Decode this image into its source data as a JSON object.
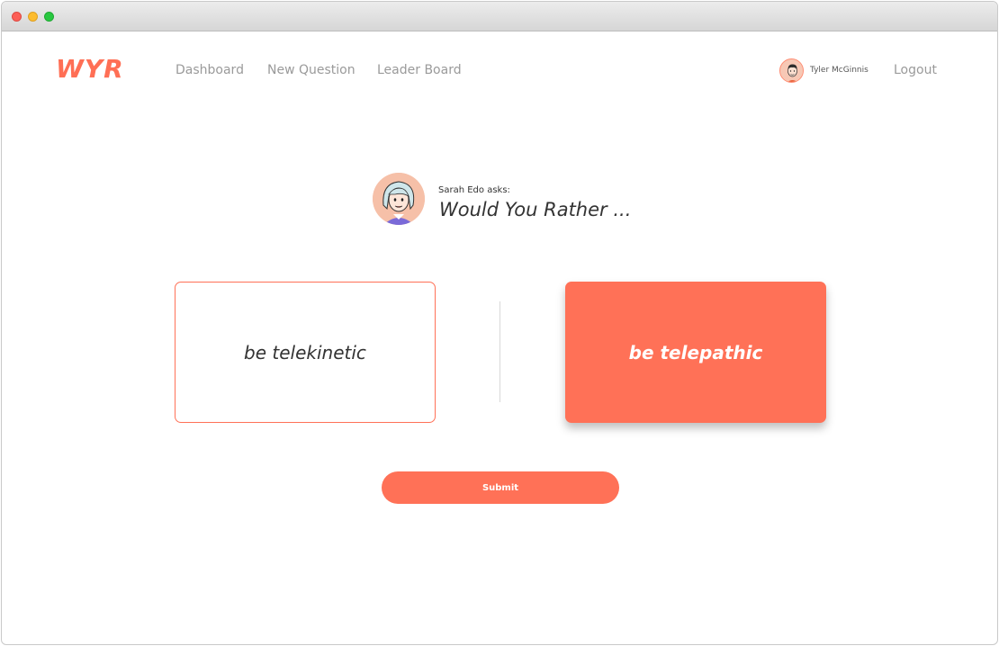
{
  "window": {
    "controls": [
      "close",
      "minimize",
      "zoom"
    ]
  },
  "header": {
    "logo": "WYR",
    "nav": [
      "Dashboard",
      "New Question",
      "Leader Board"
    ],
    "user_name": "Tyler McGinnis",
    "logout_label": "Logout"
  },
  "question": {
    "asker_label": "Sarah Edo asks:",
    "title": "Would You Rather ...",
    "option_one": "be telekinetic",
    "option_two": "be telepathic",
    "selected_option": "option_two"
  },
  "actions": {
    "submit_label": "Submit"
  },
  "colors": {
    "accent": "#ff7157",
    "nav_text": "#9a9a9a",
    "text": "#333333"
  }
}
